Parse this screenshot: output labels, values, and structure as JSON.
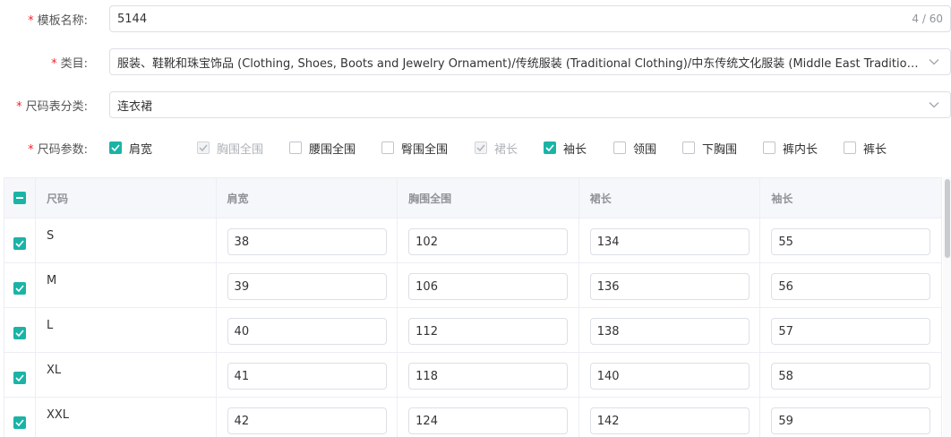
{
  "form": {
    "name": {
      "label": "模板名称:",
      "value": "5144",
      "counter": "4 / 60"
    },
    "category": {
      "label": "类目:",
      "value": "服装、鞋靴和珠宝饰品 (Clothing, Shoes, Boots and Jewelry Ornament)/传统服装 (Traditional Clothing)/中东传统文化服装 (Middle East Traditional ..."
    },
    "size_type": {
      "label": "尺码表分类:",
      "value": "连衣裙"
    },
    "params": {
      "label": "尺码参数:",
      "items": [
        {
          "label": "肩宽",
          "state": "checked"
        },
        {
          "label": "胸围全围",
          "state": "disabled-checked"
        },
        {
          "label": "腰围全围",
          "state": "unchecked"
        },
        {
          "label": "臀围全围",
          "state": "unchecked"
        },
        {
          "label": "裙长",
          "state": "disabled-checked"
        },
        {
          "label": "袖长",
          "state": "checked"
        },
        {
          "label": "领围",
          "state": "unchecked"
        },
        {
          "label": "下胸围",
          "state": "unchecked"
        },
        {
          "label": "裤内长",
          "state": "unchecked"
        },
        {
          "label": "裤长",
          "state": "unchecked"
        }
      ]
    }
  },
  "table": {
    "headers": [
      "尺码",
      "肩宽",
      "胸围全围",
      "裙长",
      "袖长"
    ],
    "rows": [
      {
        "size": "S",
        "values": [
          "38",
          "102",
          "134",
          "55"
        ]
      },
      {
        "size": "M",
        "values": [
          "39",
          "106",
          "136",
          "56"
        ]
      },
      {
        "size": "L",
        "values": [
          "40",
          "112",
          "138",
          "57"
        ]
      },
      {
        "size": "XL",
        "values": [
          "41",
          "118",
          "140",
          "58"
        ]
      },
      {
        "size": "XXL",
        "values": [
          "42",
          "124",
          "142",
          "59"
        ]
      }
    ]
  },
  "colors": {
    "accent": "#1ab4a6",
    "required": "#f5222d"
  }
}
